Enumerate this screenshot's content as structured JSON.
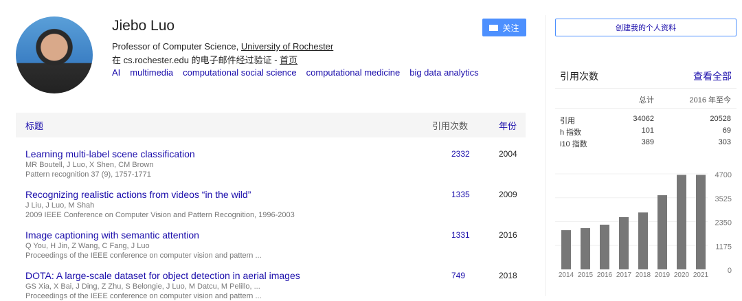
{
  "profile": {
    "name": "Jiebo Luo",
    "affiliation_prefix": "Professor of Computer Science, ",
    "affiliation_link": "University of Rochester",
    "verified_prefix": "在 cs.rochester.edu 的电子邮件经过验证 - ",
    "homepage": "首页",
    "interests": [
      "AI",
      "multimedia",
      "computational social science",
      "computational medicine",
      "big data analytics"
    ]
  },
  "buttons": {
    "follow": "关注",
    "create": "创建我的个人资料"
  },
  "table": {
    "col_title": "标题",
    "col_cited": "引用次数",
    "col_year": "年份",
    "rows": [
      {
        "title": "Learning multi-label scene classification",
        "authors": "MR Boutell, J Luo, X Shen, CM Brown",
        "venue": "Pattern recognition 37 (9), 1757-1771",
        "cited": "2332",
        "year": "2004"
      },
      {
        "title": "Recognizing realistic actions from videos “in the wild”",
        "authors": "J Liu, J Luo, M Shah",
        "venue": "2009 IEEE Conference on Computer Vision and Pattern Recognition, 1996-2003",
        "cited": "1335",
        "year": "2009"
      },
      {
        "title": "Image captioning with semantic attention",
        "authors": "Q You, H Jin, Z Wang, C Fang, J Luo",
        "venue": "Proceedings of the IEEE conference on computer vision and pattern ...",
        "cited": "1331",
        "year": "2016"
      },
      {
        "title": "DOTA: A large-scale dataset for object detection in aerial images",
        "authors": "GS Xia, X Bai, J Ding, Z Zhu, S Belongie, J Luo, M Datcu, M Pelillo, ...",
        "venue": "Proceedings of the IEEE conference on computer vision and pattern ...",
        "cited": "749",
        "year": "2018"
      }
    ]
  },
  "stats": {
    "title": "引用次数",
    "view_all": "查看全部",
    "col_total": "总计",
    "col_since": "2016 年至今",
    "rows": [
      {
        "label": "引用",
        "total": "34062",
        "since": "20528"
      },
      {
        "label": "h 指数",
        "total": "101",
        "since": "69"
      },
      {
        "label": "i10 指数",
        "total": "389",
        "since": "303"
      }
    ]
  },
  "chart_data": {
    "type": "bar",
    "categories": [
      "2014",
      "2015",
      "2016",
      "2017",
      "2018",
      "2019",
      "2020",
      "2021"
    ],
    "values": [
      1930,
      2030,
      2200,
      2570,
      2800,
      3650,
      4650,
      4650
    ],
    "yticks": [
      "0",
      "1175",
      "2350",
      "3525",
      "4700"
    ],
    "ylim": [
      0,
      4700
    ],
    "title": "",
    "xlabel": "",
    "ylabel": "",
    "bar_color": "#777777"
  }
}
